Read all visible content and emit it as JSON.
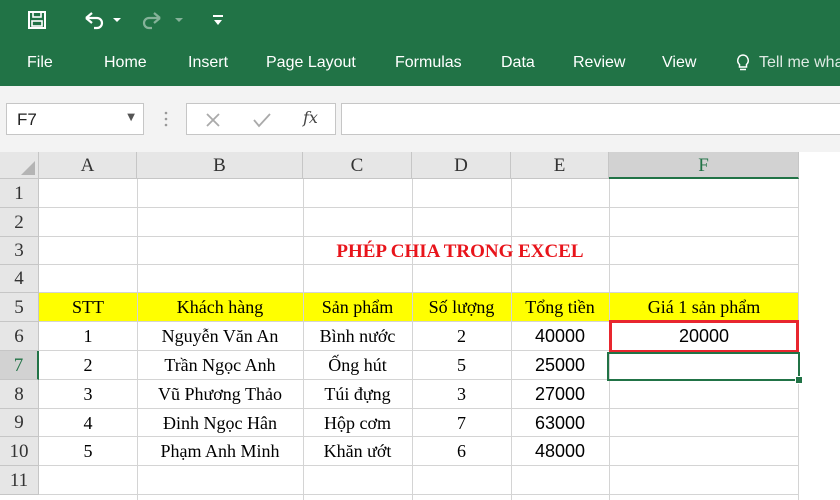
{
  "quick_access": {
    "save_icon": "save-icon",
    "undo_icon": "undo-icon",
    "redo_icon": "redo-icon",
    "customize_icon": "customize-icon"
  },
  "menu": {
    "file": "File",
    "home": "Home",
    "insert": "Insert",
    "page_layout": "Page Layout",
    "formulas": "Formulas",
    "data": "Data",
    "review": "Review",
    "view": "View",
    "tell_me": "Tell me wha"
  },
  "formula_bar": {
    "name_box": "F7",
    "formula": ""
  },
  "columns": [
    "A",
    "B",
    "C",
    "D",
    "E",
    "F"
  ],
  "rows": [
    "1",
    "2",
    "3",
    "4",
    "5",
    "6",
    "7",
    "8",
    "9",
    "10",
    "11"
  ],
  "active_column": "F",
  "active_row": "7",
  "sheet": {
    "title": "PHÉP CHIA TRONG EXCEL",
    "headers": [
      "STT",
      "Khách hàng",
      "Sản phẩm",
      "Số lượng",
      "Tổng tiền",
      "Giá 1 sản phẩm"
    ],
    "records": [
      [
        "1",
        "Nguyễn Văn An",
        "Bình nước",
        "2",
        "40000",
        "20000"
      ],
      [
        "2",
        "Trần Ngọc Anh",
        "Ống hút",
        "5",
        "25000",
        ""
      ],
      [
        "3",
        "Vũ Phương Thảo",
        "Túi đựng",
        "3",
        "27000",
        ""
      ],
      [
        "4",
        "Đinh Ngọc Hân",
        "Hộp cơm",
        "7",
        "63000",
        ""
      ],
      [
        "5",
        "Phạm Anh Minh",
        "Khăn ướt",
        "6",
        "48000",
        ""
      ]
    ]
  },
  "colors": {
    "ribbon": "#217346",
    "header_fill": "#ffff00",
    "title": "#e8141b",
    "highlight_border": "#e8262e"
  }
}
